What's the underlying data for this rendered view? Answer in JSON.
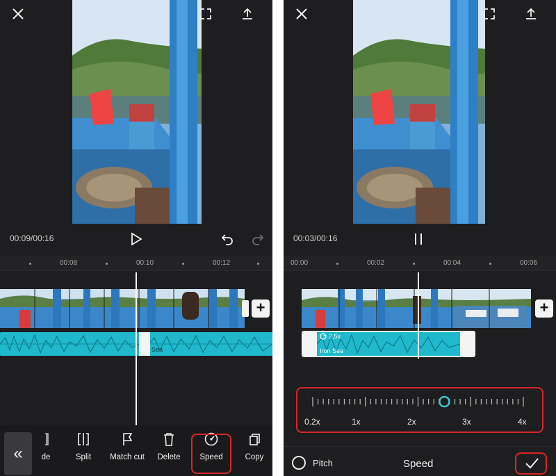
{
  "left": {
    "time_display": "00:09/00:16",
    "ruler_ticks": [
      "00:08",
      "00:10",
      "00:12"
    ],
    "audio_label": "Sea",
    "toolbar": {
      "back_icon": "«",
      "partial_label": "de",
      "items": [
        "Split",
        "Match cut",
        "Delete",
        "Speed",
        "Copy"
      ]
    }
  },
  "right": {
    "time_display": "00:03/00:16",
    "ruler_ticks": [
      "00:00",
      "00:02",
      "00:04",
      "00:06"
    ],
    "audio_speed_badge": "2,5x",
    "audio_label": "Iron Sea",
    "speed_slider": {
      "labels": [
        "0.2x",
        "1x",
        "2x",
        "3x",
        "4x"
      ],
      "value": 2.5
    },
    "pitch_label": "Pitch",
    "panel_title": "Speed"
  },
  "colors": {
    "accent": "#1fb8cc",
    "highlight_box": "#d8262a",
    "background": "#1e1e20"
  }
}
